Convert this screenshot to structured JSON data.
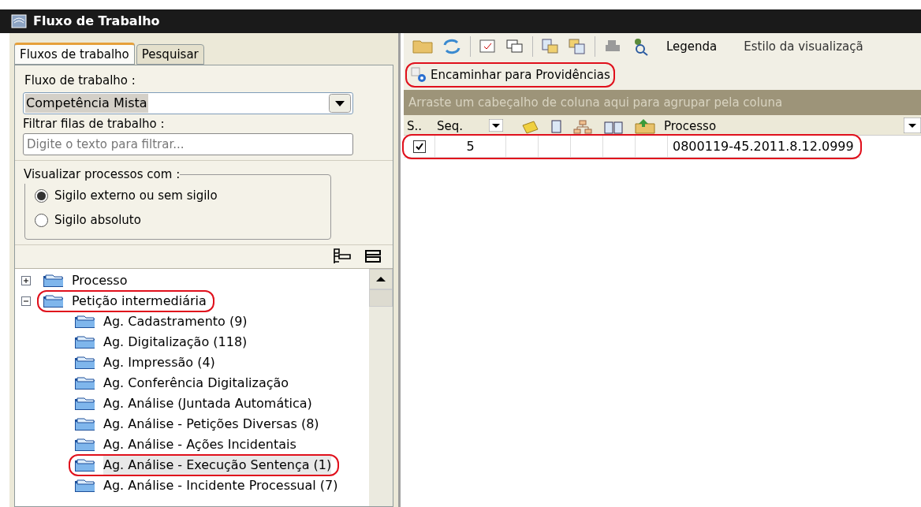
{
  "window": {
    "title": "Fluxo de Trabalho"
  },
  "tabs": [
    {
      "label": "Fluxos de trabalho",
      "selected": true
    },
    {
      "label": "Pesquisar",
      "selected": false
    }
  ],
  "workflow": {
    "label": "Fluxo de trabalho :",
    "value": "Competência Mista"
  },
  "filter": {
    "label": "Filtrar filas de trabalho :",
    "placeholder": "Digite o texto para filtrar..."
  },
  "visibility": {
    "legend": "Visualizar processos com :",
    "options": [
      {
        "label": "Sigilo externo ou sem sigilo",
        "selected": true
      },
      {
        "label": "Sigilo absoluto",
        "selected": false
      }
    ]
  },
  "tree": [
    {
      "label": "Processo",
      "expanded": false,
      "highlighted": false
    },
    {
      "label": "Petição intermediária",
      "expanded": true,
      "highlighted": true,
      "children": [
        {
          "label": "Ag. Cadastramento (9)",
          "highlighted": false
        },
        {
          "label": "Ag. Digitalização (118)",
          "highlighted": false
        },
        {
          "label": "Ag. Impressão (4)",
          "highlighted": false
        },
        {
          "label": "Ag. Conferência Digitalização",
          "highlighted": false
        },
        {
          "label": "Ag. Análise (Juntada Automática)",
          "highlighted": false
        },
        {
          "label": "Ag. Análise - Petições Diversas (8)",
          "highlighted": false
        },
        {
          "label": "Ag. Análise - Ações Incidentais",
          "highlighted": false
        },
        {
          "label": "Ag. Análise - Execução Sentença (1)",
          "highlighted": true
        },
        {
          "label": "Ag. Análise - Incidente Processual (7)",
          "highlighted": false
        }
      ]
    }
  ],
  "toolbar": {
    "legend": "Legenda",
    "view_style": "Estilo da visualizaçã"
  },
  "action": {
    "label": "Encaminhar para Providências",
    "highlighted": true
  },
  "grid": {
    "group_hint": "Arraste um cabeçalho de coluna aqui para agrupar pela coluna",
    "columns": {
      "select": "S..",
      "seq": "Seq.",
      "process": "Processo"
    },
    "rows": [
      {
        "checked": true,
        "seq": "5",
        "process": "0800119-45.2011.8.12.0999",
        "highlighted": true
      }
    ]
  }
}
